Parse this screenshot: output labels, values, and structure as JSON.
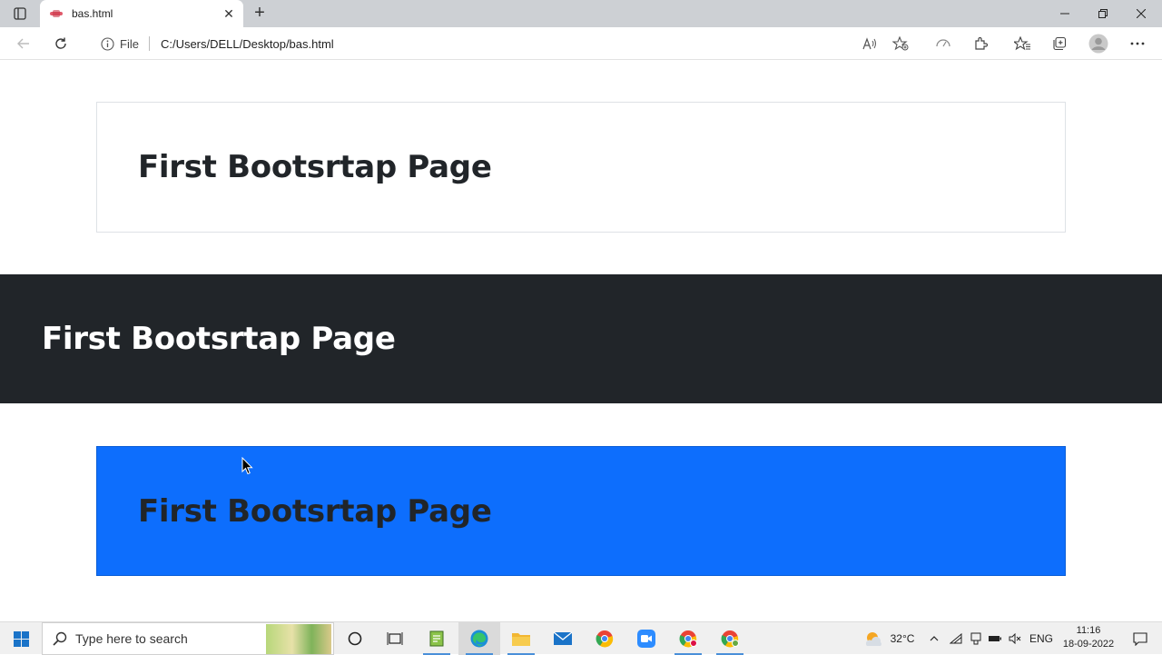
{
  "browser": {
    "tab_title": "bas.html",
    "new_tab_symbol": "+",
    "close_symbol": "✕",
    "scheme_label": "File",
    "url": "C:/Users/DELL/Desktop/bas.html"
  },
  "page": {
    "jumbotron_light_heading": "First Bootsrtap Page",
    "jumbotron_dark_heading": "First Bootsrtap Page",
    "jumbotron_primary_heading": "First Bootsrtap Page"
  },
  "taskbar": {
    "search_placeholder": "Type here to search",
    "weather": "32°C",
    "language": "ENG",
    "time": "11:16",
    "date": "18-09-2022"
  },
  "colors": {
    "dark_bg": "#212529",
    "primary_bg": "#0d6efd",
    "tab_strip": "#cdd0d4"
  }
}
